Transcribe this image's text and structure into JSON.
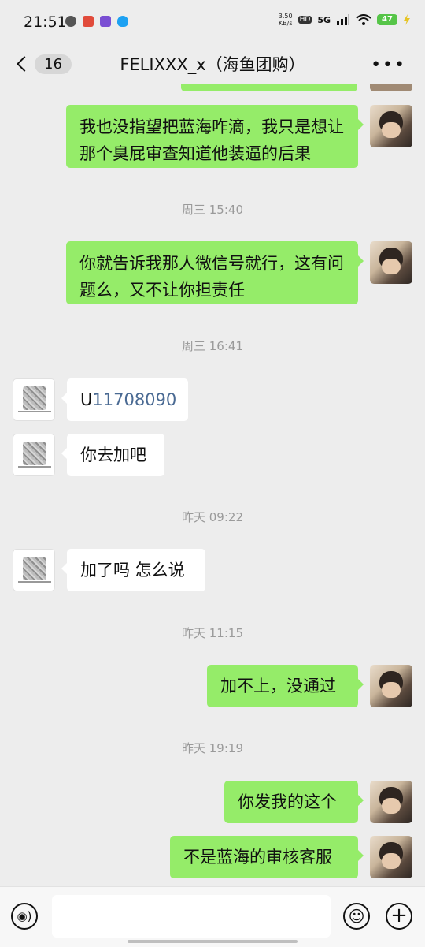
{
  "status_bar": {
    "time": "21:51",
    "net_speed_value": "3.50",
    "net_speed_unit": "KB/s",
    "hd_label": "HD",
    "network_label": "5G",
    "battery_level": "47",
    "notif_icons": [
      "wechat-icon",
      "app-red-icon",
      "app-purple-icon",
      "qq-icon"
    ],
    "signal_icon": "signal-icon",
    "wifi_icon": "wifi-icon",
    "charging_icon": "lightning-icon"
  },
  "header": {
    "back_icon": "chevron-left-icon",
    "unread_count": "16",
    "title": "FELIXXX_x（海鱼团购）",
    "more_icon": "more-dots-icon",
    "more_label": "•••"
  },
  "messages": [
    {
      "side": "self",
      "text": "我也没指望把蓝海咋滴，我只是想让那个臭屁审查知道他装逼的后果"
    },
    {
      "timestamp": "周三 15:40"
    },
    {
      "side": "self",
      "text": "你就告诉我那人微信号就行，这有问题么，又不让你担责任"
    },
    {
      "timestamp": "周三 16:41"
    },
    {
      "side": "other",
      "text_prefix": "U",
      "text_link": "11708090"
    },
    {
      "side": "other",
      "text": "你去加吧"
    },
    {
      "timestamp": "昨天 09:22"
    },
    {
      "side": "other",
      "text": "加了吗 怎么说"
    },
    {
      "timestamp": "昨天 11:15"
    },
    {
      "side": "self",
      "text": "加不上，没通过"
    },
    {
      "timestamp": "昨天 19:19"
    },
    {
      "side": "self",
      "text": "你发我的这个"
    },
    {
      "side": "self",
      "text": "不是蓝海的审核客服"
    }
  ],
  "input_bar": {
    "voice_icon": "voice-icon",
    "voice_glyph": "◉)",
    "input_value": "",
    "emoji_icon": "emoji-icon",
    "emoji_glyph": "☺",
    "plus_icon": "plus-icon",
    "plus_glyph": "+"
  },
  "colors": {
    "background": "#ededed",
    "self_bubble": "#95ec69",
    "other_bubble": "#ffffff",
    "timestamp_text": "#9a9a9a",
    "link_number": "#4a6a93",
    "battery": "#56c548"
  }
}
